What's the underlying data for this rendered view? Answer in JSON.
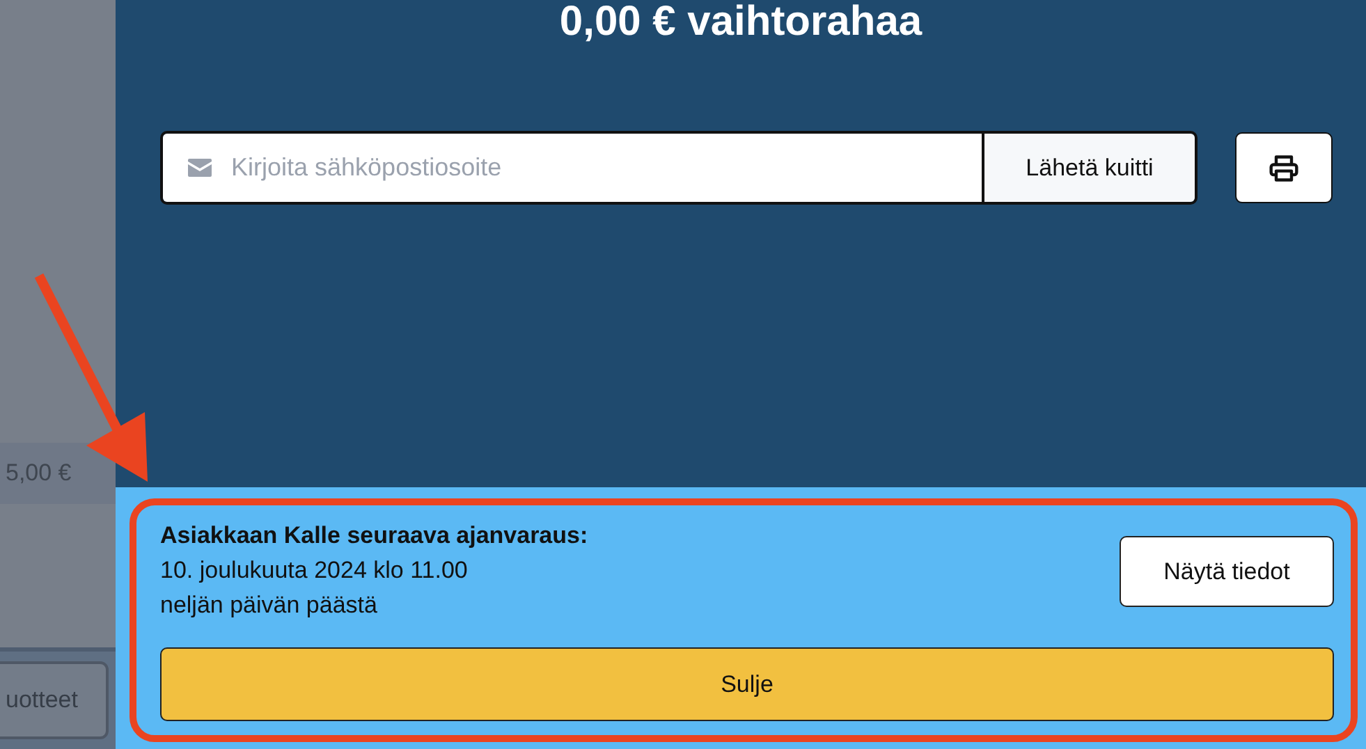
{
  "side_panel": {
    "price": "5,00 €",
    "button": "uotteet"
  },
  "change": {
    "title": "0,00 € vaihtorahaa"
  },
  "receipt": {
    "email_placeholder": "Kirjoita sähköpostiosoite",
    "send_button": "Lähetä kuitti"
  },
  "notice": {
    "title": "Asiakkaan Kalle seuraava ajanvaraus:",
    "date": "10. joulukuuta 2024 klo 11.00",
    "relative": "neljän päivän päästä",
    "details_button": "Näytä tiedot",
    "close_button": "Sulje"
  }
}
